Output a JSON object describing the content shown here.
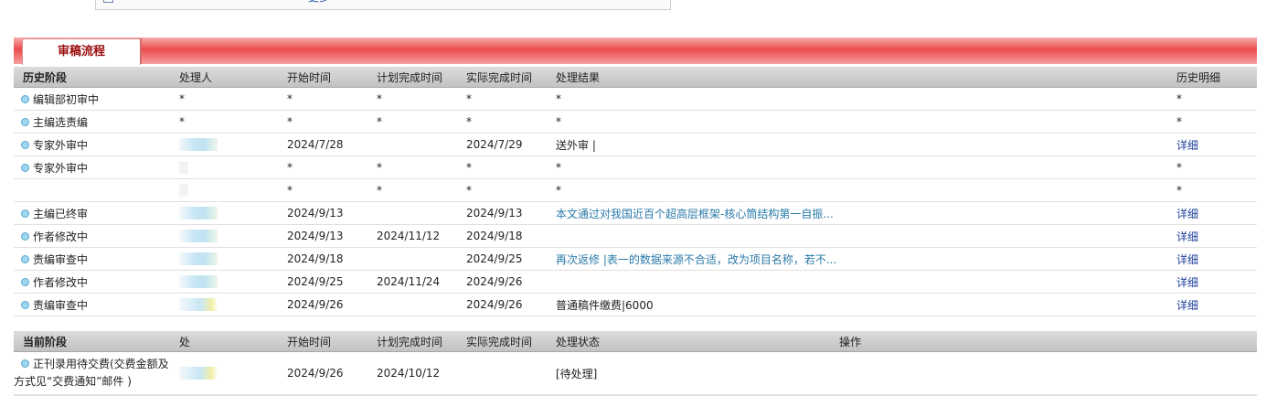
{
  "top": {
    "more_link": "更多"
  },
  "tab": {
    "label": "审稿流程"
  },
  "history": {
    "headers": [
      "历史阶段",
      "处理人",
      "开始时间",
      "计划完成时间",
      "实际完成时间",
      "处理结果",
      "历史明细"
    ],
    "rows": [
      {
        "stage": "编辑部初审中",
        "handler": "*",
        "start": "*",
        "planned": "*",
        "actual": "*",
        "result": "*",
        "detail": "*"
      },
      {
        "stage": "主编选责编",
        "handler": "*",
        "start": "*",
        "planned": "*",
        "actual": "*",
        "result": "*",
        "detail": "*"
      },
      {
        "stage": "专家外审中",
        "handler": "",
        "start": "2024/7/28",
        "planned": "",
        "actual": "2024/7/29",
        "result": "送外审 |",
        "detail": "详细"
      },
      {
        "stage": "专家外审中",
        "handler": "",
        "start": "*",
        "planned": "*",
        "actual": "*",
        "result": "*",
        "detail": "*"
      },
      {
        "stage": "",
        "handler": "",
        "start": "*",
        "planned": "*",
        "actual": "*",
        "result": "*",
        "detail": "*"
      },
      {
        "stage": "主编已终审",
        "handler": "",
        "start": "2024/9/13",
        "planned": "",
        "actual": "2024/9/13",
        "result": "本文通过对我国近百个超高层框架-核心筒结构第一自振...",
        "detail": "详细"
      },
      {
        "stage": "作者修改中",
        "handler": "",
        "start": "2024/9/13",
        "planned": "2024/11/12",
        "actual": "2024/9/18",
        "result": "",
        "detail": "详细"
      },
      {
        "stage": "责编审查中",
        "handler": "",
        "start": "2024/9/18",
        "planned": "",
        "actual": "2024/9/25",
        "result": "再次返修 |表一的数据来源不合适，改为项目名称，若不...",
        "detail": "详细"
      },
      {
        "stage": "作者修改中",
        "handler": "",
        "start": "2024/9/25",
        "planned": "2024/11/24",
        "actual": "2024/9/26",
        "result": "",
        "detail": "详细"
      },
      {
        "stage": "责编审查中",
        "handler": "",
        "start": "2024/9/26",
        "planned": "",
        "actual": "2024/9/26",
        "result": "普通稿件缴费|6000",
        "detail": "详细"
      }
    ]
  },
  "current": {
    "headers": [
      "当前阶段",
      "处",
      "开始时间",
      "计划完成时间",
      "实际完成时间",
      "处理状态",
      "操作"
    ],
    "row": {
      "stage_line1": "正刊录用待交费(交费金额及",
      "stage_line2": "方式见“交费通知”邮件 )",
      "start": "2024/9/26",
      "planned": "2024/10/12",
      "actual": "",
      "status": "[待处理]",
      "operation": ""
    }
  },
  "colors": {
    "tab_text": "#9a0c0c",
    "band": "#ea4c4c",
    "link": "#2a7aa8",
    "detail": "#1d3f9a"
  }
}
